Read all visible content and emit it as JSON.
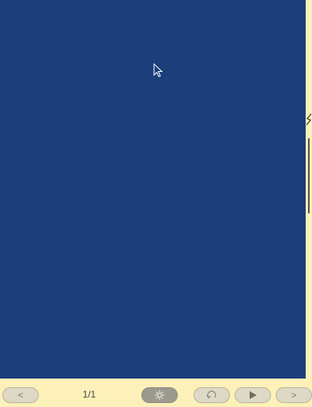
{
  "viewer": {
    "page_counter": "1/1",
    "prev_label": "<",
    "next_label": ">"
  },
  "colors": {
    "slide_background": "#1c3f7b",
    "toolbar_background": "#fdf0b8"
  },
  "icons": {
    "center": "settings-icon",
    "undo": "undo-icon",
    "play": "play-icon"
  }
}
